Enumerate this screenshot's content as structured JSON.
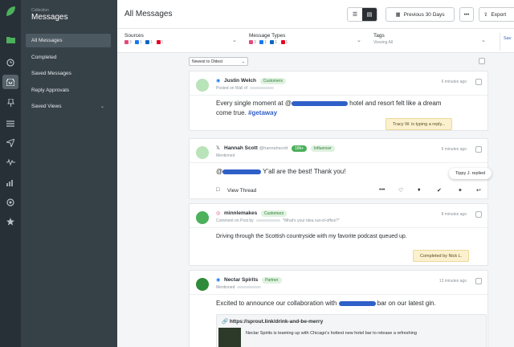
{
  "rail": {
    "brand_color": "#4cb05c",
    "icons": [
      "logo",
      "inbox-folder-icon",
      "clock-icon",
      "tray-icon",
      "pin-icon",
      "list-icon",
      "paper-plane-icon",
      "wave-icon",
      "bar-chart-icon",
      "shield-icon",
      "star-icon"
    ]
  },
  "nav": {
    "subtitle": "Collection",
    "title": "Messages",
    "items": [
      {
        "label": "All Messages"
      },
      {
        "label": "Completed"
      },
      {
        "label": "Saved Messages"
      },
      {
        "label": "Reply Approvals"
      },
      {
        "label": "Saved Views"
      }
    ]
  },
  "header": {
    "title": "All Messages",
    "date_range": "Previous 30 Days",
    "more": "•••",
    "export": "Export"
  },
  "filters": {
    "sources": {
      "label": "Sources",
      "counts": [
        "3",
        "1",
        "1",
        "1"
      ]
    },
    "message_types": {
      "label": "Message Types",
      "counts": [
        "3",
        "1",
        "1",
        "1"
      ]
    },
    "tags": {
      "label": "Tags",
      "summary": "Viewing All"
    },
    "extra": "Sav"
  },
  "feed": {
    "sort": "Newest to Oldest",
    "tooltip": "Tippy J. replied",
    "messages": [
      {
        "author": "Justin Welch",
        "tag": "Customers",
        "meta": "Posted on Wall of",
        "time": "6 minutes ago",
        "text_before": "Every single moment at @",
        "text_after": " hotel and resort felt like a dream come true. ",
        "hashtag": "#getaway",
        "status": "Tracy W. is typing a reply..."
      },
      {
        "author": "Hannah Scott",
        "handle": "@hannahscott",
        "tag_count": "18k+",
        "tag": "Influencer",
        "meta": "Mentioned",
        "time": "6 minutes ago",
        "text_before": "@",
        "text_after": " Y'all are the best! Thank you!",
        "view_thread": "View Thread"
      },
      {
        "author": "minnlemakes",
        "tag": "Customers",
        "meta": "Comment on Post by",
        "meta_quote": "\"What's your idea out-of-office?\"",
        "time": "8 minutes ago",
        "text": "Driving through the Scottish countryside with my favorite podcast queued up.",
        "status": "Completed by Nick L."
      },
      {
        "author": "Nectar Spirits",
        "tag": "Partner",
        "meta": "Mentioned",
        "time": "13 minutes ago",
        "text_before": "Excited to announce our collaboration with ",
        "text_after": " bar on our latest gin.",
        "link_url": "https://sprout.link/drink-and-be-merry",
        "link_text": "Nectar Spirits is teaming up with Chicago's hottest new hotel bar to release a refreshing"
      }
    ]
  }
}
